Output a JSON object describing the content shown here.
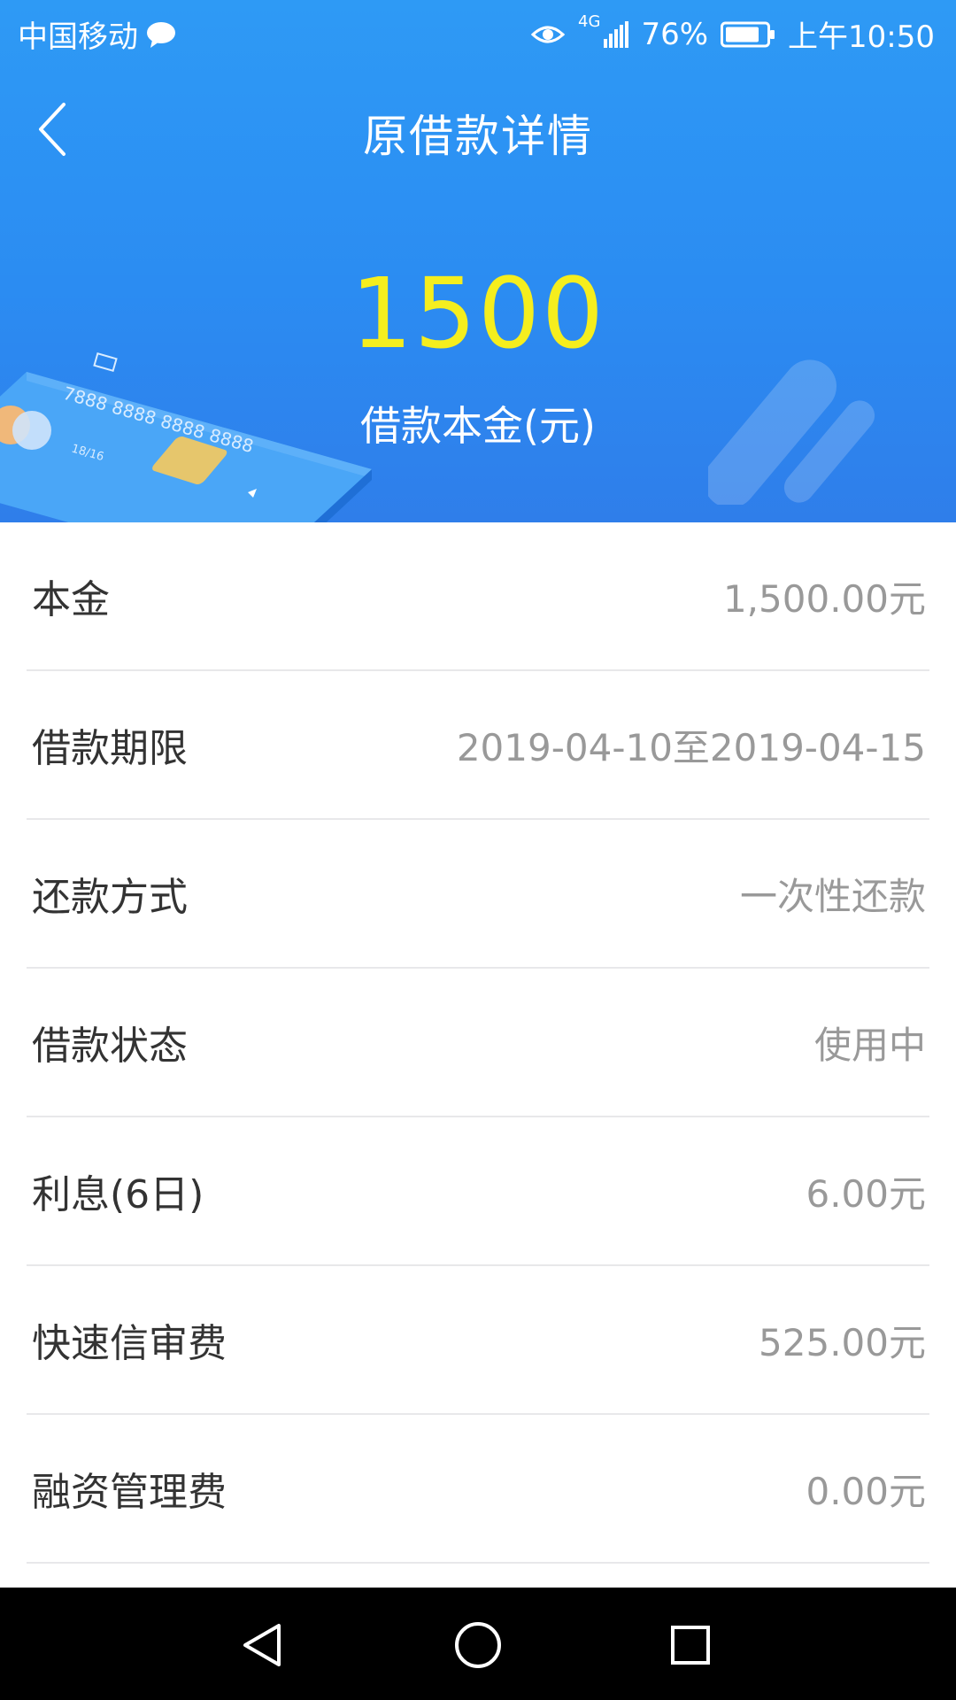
{
  "status_bar": {
    "carrier": "中国移动",
    "network": "4G",
    "battery": "76%",
    "time": "上午10:50"
  },
  "nav": {
    "title": "原借款详情"
  },
  "hero": {
    "amount": "1500",
    "amount_label": "借款本金(元)",
    "card_number": "7888 8888 8888 8888",
    "card_expiry": "18/16"
  },
  "details": [
    {
      "label": "本金",
      "value": "1,500.00元"
    },
    {
      "label": "借款期限",
      "value": "2019-04-10至2019-04-15"
    },
    {
      "label": "还款方式",
      "value": "一次性还款"
    },
    {
      "label": "借款状态",
      "value": "使用中"
    },
    {
      "label": "利息(6日)",
      "value": "6.00元"
    },
    {
      "label": "快速信审费",
      "value": "525.00元"
    },
    {
      "label": "融资管理费",
      "value": "0.00元"
    }
  ],
  "colors": {
    "hero_blue": "#2b8cf2",
    "amount_yellow": "#f5ee1e",
    "label_text": "#333333",
    "value_text": "#999999"
  }
}
